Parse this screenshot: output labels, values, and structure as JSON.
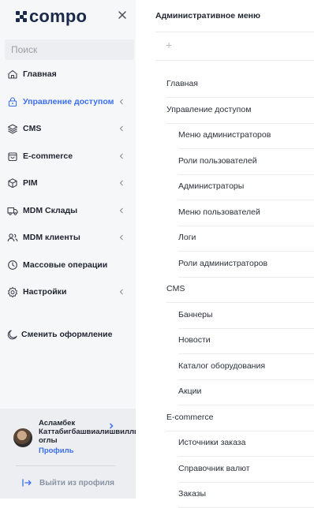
{
  "sidebar": {
    "logo_text": "compo",
    "search_placeholder": "Поиск",
    "items": [
      {
        "label": "Главная",
        "icon": "home-icon"
      },
      {
        "label": "Управление доступом",
        "icon": "lock-icon",
        "active": true
      },
      {
        "label": "CMS",
        "icon": "layers-icon"
      },
      {
        "label": "E-commerce",
        "icon": "shopping-bag-icon"
      },
      {
        "label": "PIM",
        "icon": "box-icon"
      },
      {
        "label": "MDM Склады",
        "icon": "truck-icon"
      },
      {
        "label": "MDM клиенты",
        "icon": "users-icon"
      },
      {
        "label": "Массовые операции",
        "icon": "clock-icon"
      },
      {
        "label": "Настройки",
        "icon": "settings-icon"
      }
    ],
    "theme_toggle": "Сменить оформление",
    "user": {
      "name_line1": "Асламбек",
      "name_line2": "Каттабигбашвиалишвилли",
      "name_line3": "оглы",
      "profile_link": "Профиль"
    },
    "logout": "Выйти из профиля"
  },
  "main": {
    "title": "Административное меню",
    "add_symbol": "+",
    "menu": [
      {
        "label": "Главная",
        "level": 0
      },
      {
        "label": "Управление доступом",
        "level": 0
      },
      {
        "label": "Меню администраторов",
        "level": 1
      },
      {
        "label": "Роли пользователей",
        "level": 1
      },
      {
        "label": "Администраторы",
        "level": 1
      },
      {
        "label": "Меню пользователей",
        "level": 1
      },
      {
        "label": "Логи",
        "level": 1
      },
      {
        "label": "Роли администраторов",
        "level": 1
      },
      {
        "label": "CMS",
        "level": 0
      },
      {
        "label": "Баннеры",
        "level": 1
      },
      {
        "label": "Новости",
        "level": 1
      },
      {
        "label": "Каталог оборудования",
        "level": 1
      },
      {
        "label": "Акции",
        "level": 1
      },
      {
        "label": "E-commerce",
        "level": 0
      },
      {
        "label": "Источники заказа",
        "level": 1
      },
      {
        "label": "Справочник валют",
        "level": 1
      },
      {
        "label": "Заказы",
        "level": 1
      }
    ]
  },
  "colors": {
    "accent": "#3b6df0",
    "sidebar_bg": "#f6f7f9",
    "logo": "#1b2a4a"
  }
}
